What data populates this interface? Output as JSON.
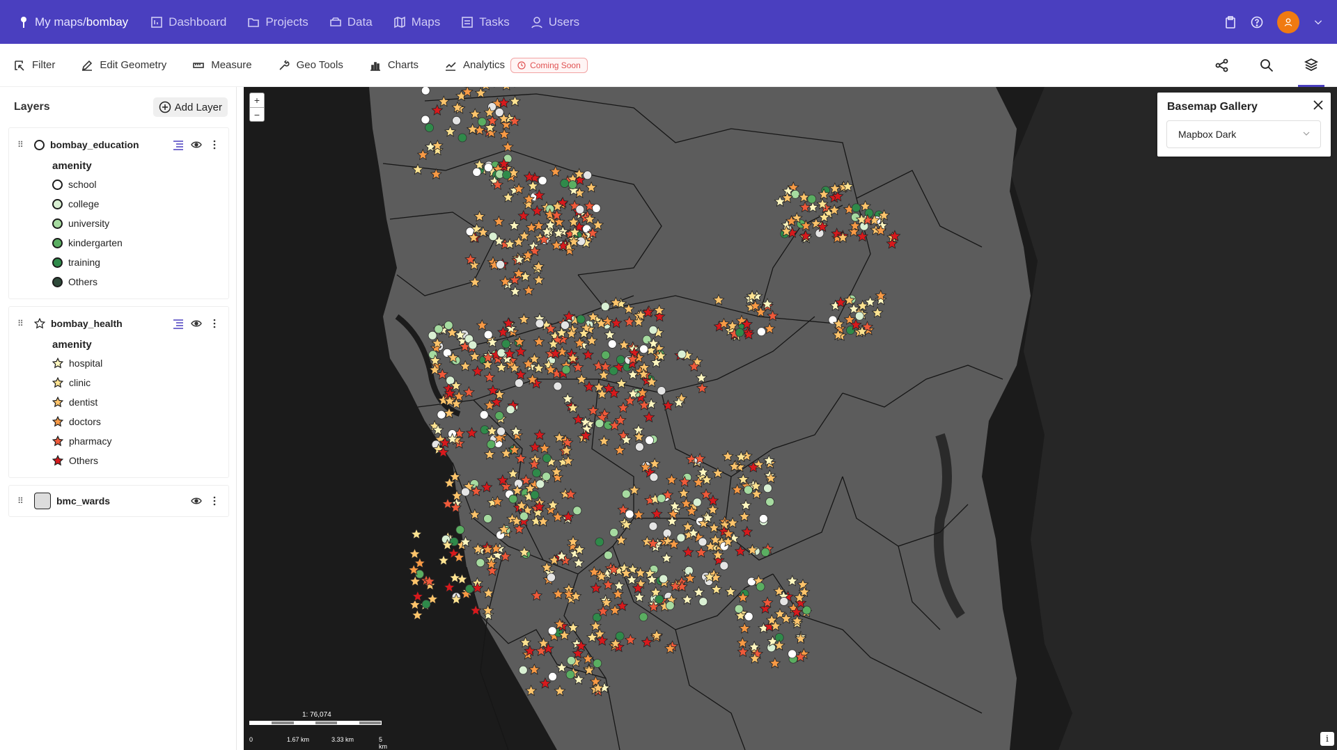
{
  "app": {
    "breadcrumb_prefix": "My maps/",
    "breadcrumb_current": "bombay"
  },
  "nav": [
    {
      "label": "Dashboard",
      "icon": "dashboard-icon"
    },
    {
      "label": "Projects",
      "icon": "folder-icon"
    },
    {
      "label": "Data",
      "icon": "database-icon"
    },
    {
      "label": "Maps",
      "icon": "map-icon"
    },
    {
      "label": "Tasks",
      "icon": "tasks-icon"
    },
    {
      "label": "Users",
      "icon": "user-icon"
    }
  ],
  "toolbar": {
    "filter": "Filter",
    "edit_geometry": "Edit Geometry",
    "measure": "Measure",
    "geo_tools": "Geo Tools",
    "charts": "Charts",
    "analytics": "Analytics",
    "coming_soon": "Coming Soon"
  },
  "panel": {
    "title": "Layers",
    "add_layer": "Add Layer",
    "layers": [
      {
        "name": "bombay_education",
        "legend_title": "amenity",
        "items": [
          {
            "label": "school",
            "color": "#ffffff"
          },
          {
            "label": "college",
            "color": "#d9f0d3"
          },
          {
            "label": "university",
            "color": "#a6dba0"
          },
          {
            "label": "kindergarten",
            "color": "#5aae61"
          },
          {
            "label": "training",
            "color": "#2f8a4a"
          },
          {
            "label": "Others",
            "color": "#2e4a3a"
          }
        ]
      },
      {
        "name": "bombay_health",
        "legend_title": "amenity",
        "items": [
          {
            "label": "hospital",
            "color": "#fff7c0"
          },
          {
            "label": "clinic",
            "color": "#fee391"
          },
          {
            "label": "dentist",
            "color": "#fdc46b"
          },
          {
            "label": "doctors",
            "color": "#f89a45"
          },
          {
            "label": "pharmacy",
            "color": "#ef5a3a"
          },
          {
            "label": "Others",
            "color": "#d7191c"
          }
        ]
      },
      {
        "name": "bmc_wards",
        "color": "#dddddd"
      }
    ]
  },
  "basemap": {
    "title": "Basemap Gallery",
    "selected": "Mapbox Dark"
  },
  "map": {
    "scale_ratio": "1: 76,074",
    "scale_labels": [
      "0",
      "1.67 km",
      "3.33 km",
      "5 km"
    ],
    "land_color": "#5c5c5c",
    "water_color": "#1b1b1b",
    "east_land_color": "#262626"
  }
}
